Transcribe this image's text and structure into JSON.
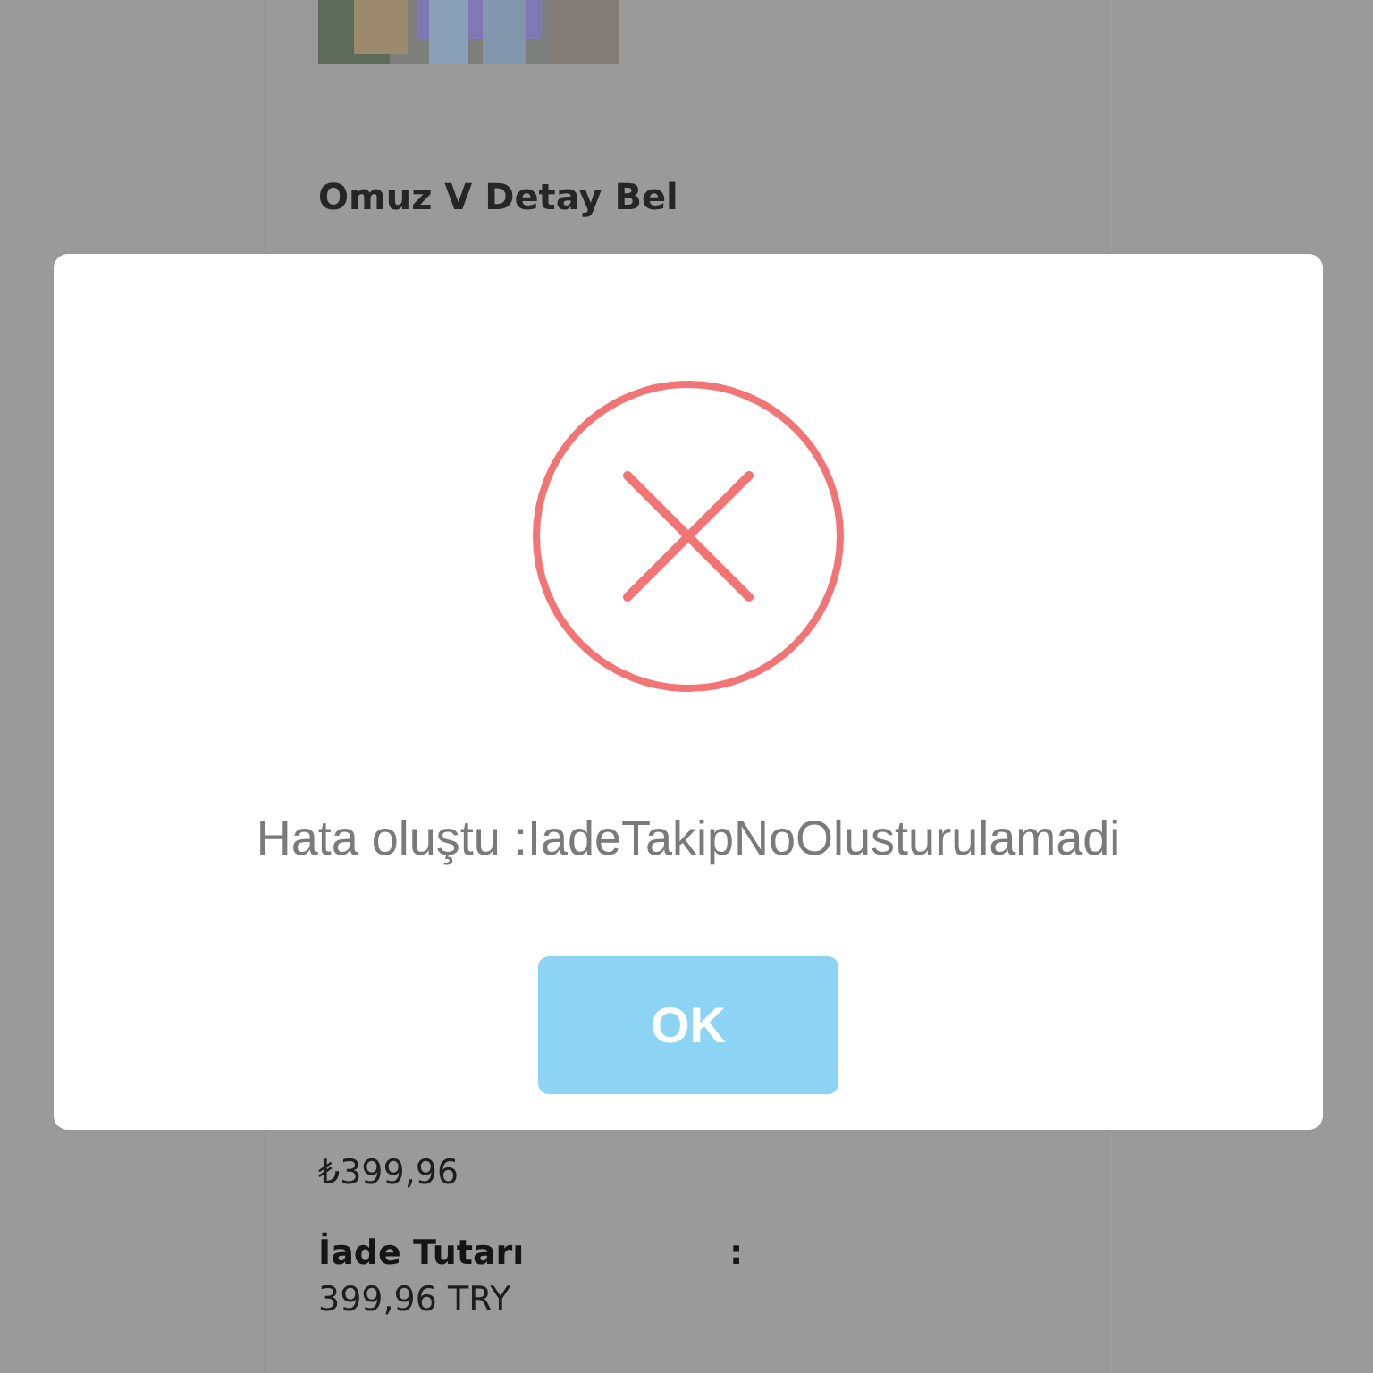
{
  "product": {
    "title_lines": [
      "Omuz V Detay Bel"
    ]
  },
  "summary": [
    {
      "value": "₺399,96"
    },
    {
      "label": "İade Tutarı",
      "separator": ":",
      "value": "399,96 TRY"
    }
  ],
  "dialog": {
    "kind": "error",
    "message": "Hata oluştu :IadeTakipNoOlusturulamadi",
    "button": "OK"
  }
}
